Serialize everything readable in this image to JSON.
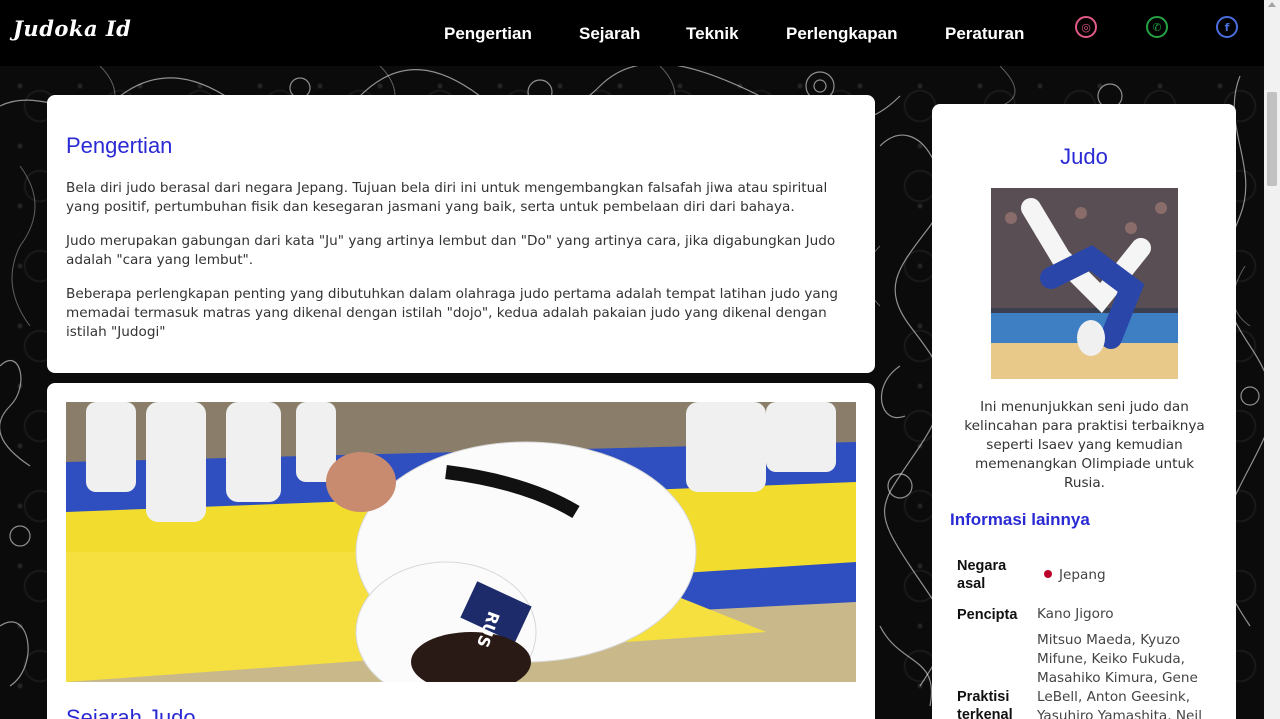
{
  "nav": {
    "logo": "Judoka Id",
    "items": [
      "Pengertian",
      "Sejarah",
      "Teknik",
      "Perlengkapan",
      "Peraturan"
    ],
    "social": [
      {
        "icon": "instagram-icon",
        "color": "#e05a8a",
        "glyph": "◎"
      },
      {
        "icon": "whatsapp-icon",
        "color": "#25a244",
        "glyph": "✆"
      },
      {
        "icon": "facebook-icon",
        "color": "#4a6ee0",
        "glyph": "f"
      }
    ]
  },
  "pengertian": {
    "title": "Pengertian",
    "paragraphs": [
      "Bela diri judo berasal dari negara Jepang. Tujuan bela diri ini untuk mengembangkan falsafah jiwa atau spiritual yang positif, pertumbuhan fisik dan kesegaran jasmani yang baik, serta untuk pembelaan diri dari bahaya.",
      "Judo merupakan gabungan dari kata \"Ju\" yang artinya lembut dan \"Do\" yang artinya cara, jika digabungkan Judo adalah \"cara yang lembut\".",
      "Beberapa perlengkapan penting yang dibutuhkan dalam olahraga judo pertama adalah tempat latihan judo yang memadai termasuk matras yang dikenal dengan istilah \"dojo\", kedua adalah pakaian judo yang dikenal dengan istilah \"Judogi\""
    ]
  },
  "sejarah": {
    "title": "Sejarah Judo",
    "photo_text": "RUS"
  },
  "sidebar": {
    "title": "Judo",
    "caption": "Ini menunjukkan seni judo dan kelincahan para praktisi terbaiknya seperti Isaev yang kemudian memenangkan Olimpiade untuk Rusia.",
    "info_title": "Informasi lainnya",
    "rows": [
      {
        "label": "Negara asal",
        "value": "Jepang"
      },
      {
        "label": "Pencipta",
        "value": "Kano Jigoro"
      },
      {
        "label": "Praktisi terkenal",
        "value": "Mitsuo Maeda, Kyuzo Mifune, Keiko Fukuda, Masahiko Kimura, Gene LeBell, Anton Geesink, Yasuhiro Yamashita, Neil"
      }
    ]
  },
  "colors": {
    "accent": "#2a2ad4",
    "flag_dot": "#bc0029"
  }
}
